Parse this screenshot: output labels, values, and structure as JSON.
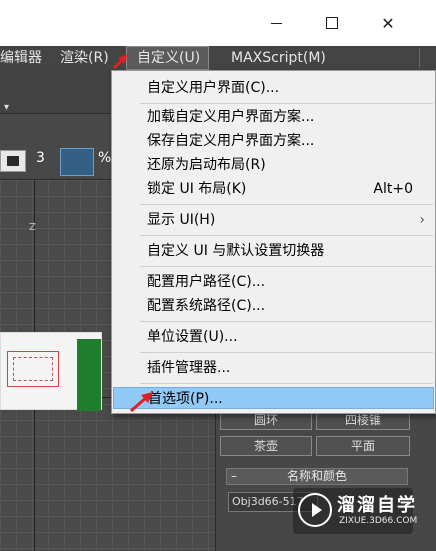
{
  "window": {
    "minimize_icon": "minimize-icon",
    "maximize_icon": "maximize-icon",
    "close_label": "✕"
  },
  "menubar": {
    "items": [
      {
        "label": "编辑器"
      },
      {
        "label": "渲染(R)"
      },
      {
        "label": "自定义(U)"
      },
      {
        "label": "MAXScript(M)"
      }
    ]
  },
  "toolbar": {
    "snap_number": "3",
    "percent_label": "%",
    "dropdown_arrow": "▾"
  },
  "viewport": {
    "axis_label": "Z"
  },
  "dropdown_menu": {
    "items": [
      {
        "label": "自定义用户界面(C)..."
      },
      {
        "label": "加载自定义用户界面方案..."
      },
      {
        "label": "保存自定义用户界面方案..."
      },
      {
        "label": "还原为启动布局(R)"
      },
      {
        "label": "锁定 UI 布局(K)",
        "shortcut": "Alt+0"
      },
      {
        "label": "显示 UI(H)",
        "submenu_arrow": "›"
      },
      {
        "label": "自定义 UI 与默认设置切换器"
      },
      {
        "label": "配置用户路径(C)..."
      },
      {
        "label": "配置系统路径(C)..."
      },
      {
        "label": "单位设置(U)..."
      },
      {
        "label": "插件管理器..."
      },
      {
        "label": "首选项(P)..."
      }
    ],
    "highlight_color": "#91c9f7"
  },
  "command_panel": {
    "buttons": [
      {
        "label": "圆环"
      },
      {
        "label": "四棱锥"
      },
      {
        "label": "茶壶"
      },
      {
        "label": "平面"
      }
    ],
    "section": {
      "collapse_label": "–",
      "title": "名称和颜色"
    },
    "name_field": {
      "value": "Obj3d66-517"
    }
  },
  "watermark": {
    "title": "溜溜自学",
    "url": "ZIXUE.3D66.COM"
  },
  "colors": {
    "arrow": "#e02020",
    "menu_bg": "#f0f0f0",
    "app_bg": "#3c3c3c"
  }
}
